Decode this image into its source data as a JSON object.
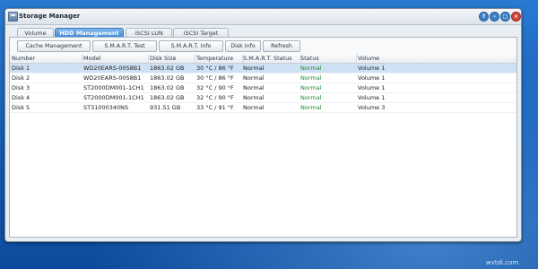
{
  "window": {
    "title": "Storage Manager",
    "buttons": [
      "?",
      "–",
      "□",
      "×"
    ]
  },
  "tabs": [
    {
      "label": "Volume"
    },
    {
      "label": "HDD Management",
      "active": true
    },
    {
      "label": "iSCSI LUN"
    },
    {
      "label": "iSCSI Target"
    }
  ],
  "toolbar": {
    "cache_management": "Cache Management",
    "smart_test": "S.M.A.R.T. Test",
    "smart_info": "S.M.A.R.T. Info",
    "disk_info": "Disk Info",
    "refresh": "Refresh"
  },
  "table": {
    "columns": [
      "Number",
      "Model",
      "Disk Size",
      "Temperature",
      "S.M.A.R.T. Status",
      "Status",
      "Volume"
    ],
    "rows": [
      {
        "number": "Disk 1",
        "model": "WD20EARS-00S8B1",
        "size": "1863.02 GB",
        "temp": "30 °C / 86 °F",
        "smart": "Normal",
        "status": "Normal",
        "volume": "Volume 1",
        "selected": true
      },
      {
        "number": "Disk 2",
        "model": "WD20EARS-00S8B1",
        "size": "1863.02 GB",
        "temp": "30 °C / 86 °F",
        "smart": "Normal",
        "status": "Normal",
        "volume": "Volume 1"
      },
      {
        "number": "Disk 3",
        "model": "ST2000DM001-1CH1",
        "size": "1863.02 GB",
        "temp": "32 °C / 90 °F",
        "smart": "Normal",
        "status": "Normal",
        "volume": "Volume 1"
      },
      {
        "number": "Disk 4",
        "model": "ST2000DM001-1CH1",
        "size": "1863.02 GB",
        "temp": "32 °C / 90 °F",
        "smart": "Normal",
        "status": "Normal",
        "volume": "Volume 1"
      },
      {
        "number": "Disk 5",
        "model": "ST31000340NS",
        "size": "931.51 GB",
        "temp": "33 °C / 91 °F",
        "smart": "Normal",
        "status": "Normal",
        "volume": "Volume 3"
      }
    ]
  },
  "watermark": "wvtdi.com",
  "colors": {
    "accent": "#3d88d6",
    "status_ok": "#1d8b2e",
    "close": "#d2413b"
  }
}
